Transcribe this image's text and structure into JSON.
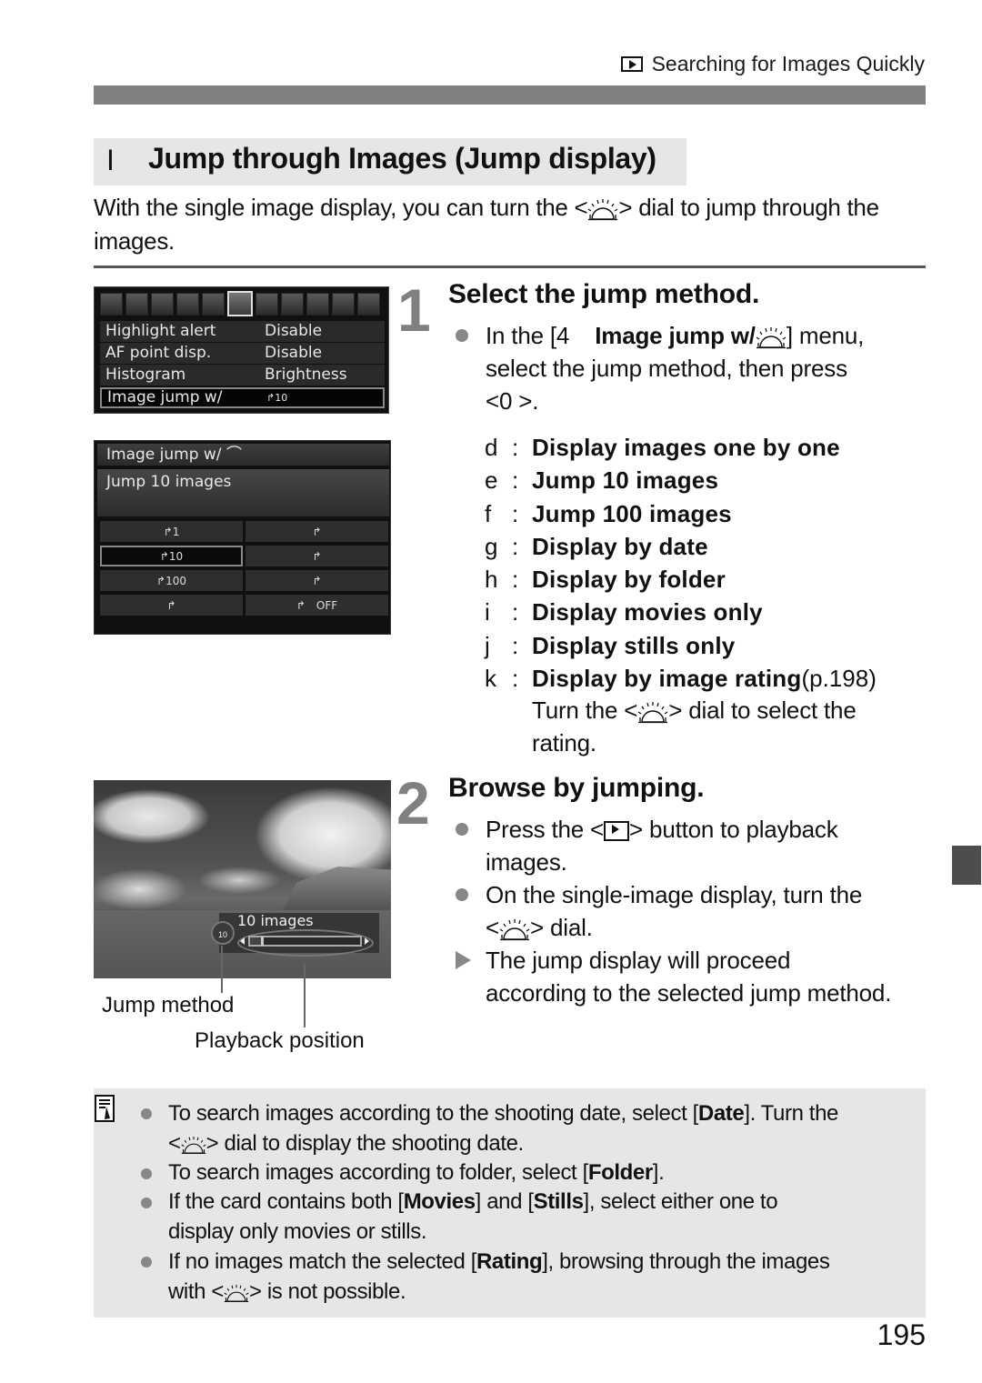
{
  "header": {
    "section_icon": "playback-icon",
    "running_title": "Searching for Images Quickly"
  },
  "section": {
    "marker": "I",
    "title": "Jump through Images (Jump display)",
    "intro_before_dial": "With the single image display, you can turn the <",
    "intro_after_dial": "> dial to jump through the images."
  },
  "camera_menu": {
    "tab_count": 11,
    "active_tab_index": 5,
    "rows": [
      {
        "key": "Highlight alert",
        "value": "Disable"
      },
      {
        "key": "AF point disp.",
        "value": "Disable"
      },
      {
        "key": "Histogram",
        "value": "Brightness"
      },
      {
        "key": "Image jump w/",
        "value": "10",
        "selected": true
      }
    ]
  },
  "jump_screen": {
    "title": "Image jump w/",
    "description": "Jump 10 images",
    "options": [
      {
        "icon": "jump-1-icon",
        "label": "1"
      },
      {
        "icon": "jump-folder-icon",
        "label": ""
      },
      {
        "icon": "jump-10-icon",
        "label": "10",
        "selected": true
      },
      {
        "icon": "jump-movie-icon",
        "label": ""
      },
      {
        "icon": "jump-100-icon",
        "label": "100"
      },
      {
        "icon": "jump-stills-icon",
        "label": ""
      },
      {
        "icon": "jump-date-icon",
        "label": ""
      },
      {
        "icon": "jump-rating-icon",
        "label": "OFF"
      }
    ]
  },
  "step1": {
    "number": "1",
    "title": "Select the jump method.",
    "bullet_part1": "In the [4",
    "bullet_bold": "Image jump w/",
    "bullet_part2": "] menu,",
    "bullet_line2": "select the jump method, then press",
    "bullet_line3": "<0   >.",
    "options": [
      {
        "letter": "d",
        "label": "Display images one by one",
        "ref": ""
      },
      {
        "letter": "e",
        "label": "Jump 10 images",
        "ref": ""
      },
      {
        "letter": "f",
        "label": "Jump 100 images",
        "ref": ""
      },
      {
        "letter": "g",
        "label": "Display by date",
        "ref": ""
      },
      {
        "letter": "h",
        "label": "Display by folder",
        "ref": ""
      },
      {
        "letter": "i",
        "label": "Display movies only",
        "ref": ""
      },
      {
        "letter": "j",
        "label": "Display stills only",
        "ref": ""
      },
      {
        "letter": "k",
        "label": "Display by image rating",
        "ref": " (p.198)"
      }
    ],
    "rating_note_before": "Turn the <",
    "rating_note_after": "> dial to select the",
    "rating_note_line2": "rating."
  },
  "playback_screen": {
    "overlay_text": "10 images",
    "jump_icon_label": "10",
    "position_fraction": 0.1,
    "callout_jump_method": "Jump method",
    "callout_playback_position": "Playback position"
  },
  "step2": {
    "number": "2",
    "title": "Browse by jumping.",
    "b1_before": "Press the <",
    "b1_after": "> button to playback",
    "b1_line2": "images.",
    "b2_line1": "On the single-image display, turn the",
    "b2_line2_before": "<",
    "b2_line2_after": "> dial.",
    "result_line1": "The jump display will proceed",
    "result_line2": "according to the selected jump method."
  },
  "notes": [
    {
      "pre": "To search images according to the shooting date, select [",
      "bold": "Date",
      "post": "]. Turn the",
      "line2_pre": "<",
      "line2_post": "> dial to display the shooting date."
    },
    {
      "pre": "To search images according to folder, select [",
      "bold": "Folder",
      "post": "]."
    },
    {
      "pre": "If the card contains both [",
      "bold": "Movies",
      "mid": "] and [",
      "bold2": "Stills",
      "post": "], select either one to",
      "line2": "display only movies or stills."
    },
    {
      "pre": "If no images match the selected [",
      "bold": "Rating",
      "post": "], browsing through the images",
      "line2_pre": "with <",
      "line2_post": "> is not possible."
    }
  ],
  "page_number": "195"
}
